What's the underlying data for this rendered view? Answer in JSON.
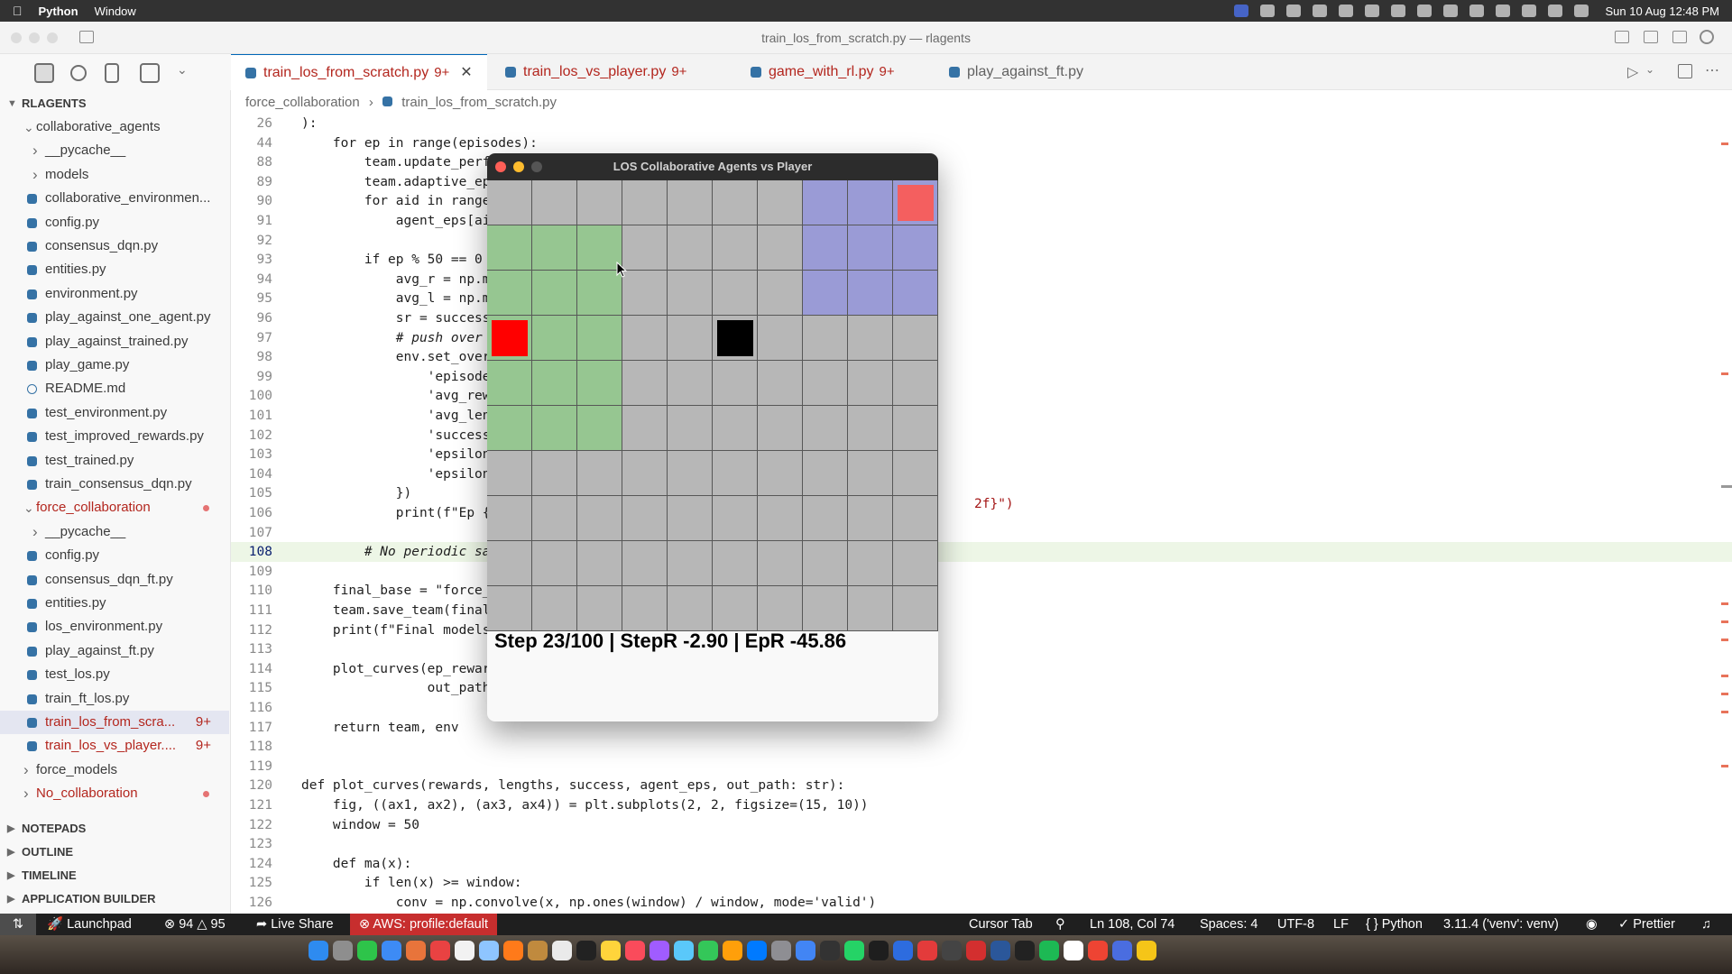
{
  "menubar": {
    "app_name": "Python",
    "menu_window": "Window",
    "clock": "Sun 10 Aug  12:48 PM"
  },
  "window": {
    "title": "train_los_from_scratch.py — rlagents"
  },
  "tabs": [
    {
      "label": "train_los_from_scratch.py",
      "badge": "9+",
      "active": true
    },
    {
      "label": "train_los_vs_player.py",
      "badge": "9+",
      "active": false
    },
    {
      "label": "game_with_rl.py",
      "badge": "9+",
      "active": false
    },
    {
      "label": "play_against_ft.py",
      "badge": "",
      "active": false
    }
  ],
  "sidebar": {
    "root": "RLAGENTS",
    "items": [
      {
        "label": "collaborative_agents",
        "kind": "folder-open",
        "indent": 0
      },
      {
        "label": "__pycache__",
        "kind": "folder",
        "indent": 1
      },
      {
        "label": "models",
        "kind": "folder",
        "indent": 1
      },
      {
        "label": "collaborative_environmen...",
        "kind": "py",
        "indent": 1
      },
      {
        "label": "config.py",
        "kind": "py",
        "indent": 1
      },
      {
        "label": "consensus_dqn.py",
        "kind": "py",
        "indent": 1
      },
      {
        "label": "entities.py",
        "kind": "py",
        "indent": 1
      },
      {
        "label": "environment.py",
        "kind": "py",
        "indent": 1
      },
      {
        "label": "play_against_one_agent.py",
        "kind": "py",
        "indent": 1
      },
      {
        "label": "play_against_trained.py",
        "kind": "py",
        "indent": 1
      },
      {
        "label": "play_game.py",
        "kind": "py",
        "indent": 1
      },
      {
        "label": "README.md",
        "kind": "info",
        "indent": 1
      },
      {
        "label": "test_environment.py",
        "kind": "py",
        "indent": 1
      },
      {
        "label": "test_improved_rewards.py",
        "kind": "py",
        "indent": 1
      },
      {
        "label": "test_trained.py",
        "kind": "py",
        "indent": 1
      },
      {
        "label": "train_consensus_dqn.py",
        "kind": "py",
        "indent": 1
      },
      {
        "label": "force_collaboration",
        "kind": "folder-open-mod",
        "indent": 0
      },
      {
        "label": "__pycache__",
        "kind": "folder",
        "indent": 1
      },
      {
        "label": "config.py",
        "kind": "py",
        "indent": 1
      },
      {
        "label": "consensus_dqn_ft.py",
        "kind": "py",
        "indent": 1
      },
      {
        "label": "entities.py",
        "kind": "py",
        "indent": 1
      },
      {
        "label": "los_environment.py",
        "kind": "py",
        "indent": 1
      },
      {
        "label": "play_against_ft.py",
        "kind": "py",
        "indent": 1
      },
      {
        "label": "test_los.py",
        "kind": "py",
        "indent": 1
      },
      {
        "label": "train_ft_los.py",
        "kind": "py",
        "indent": 1
      },
      {
        "label": "train_los_from_scra...",
        "kind": "py-mod-sel",
        "indent": 1,
        "badge": "9+"
      },
      {
        "label": "train_los_vs_player....",
        "kind": "py-mod",
        "indent": 1,
        "badge": "9+"
      },
      {
        "label": "force_models",
        "kind": "folder",
        "indent": 0
      },
      {
        "label": "No_collaboration",
        "kind": "folder-mod",
        "indent": 0
      }
    ],
    "sections": [
      "NOTEPADS",
      "OUTLINE",
      "TIMELINE",
      "APPLICATION BUILDER"
    ]
  },
  "breadcrumb": {
    "folder": "force_collaboration",
    "file": "train_los_from_scratch.py"
  },
  "editor": {
    "lines": [
      {
        "n": "26",
        "t": "):"
      },
      {
        "n": "44",
        "t": "    for ep in range(episodes):"
      },
      {
        "n": "88",
        "t": "        team.update_perf"
      },
      {
        "n": "89",
        "t": "        team.adaptive_ep"
      },
      {
        "n": "90",
        "t": "        for aid in range"
      },
      {
        "n": "91",
        "t": "            agent_eps[ai"
      },
      {
        "n": "92",
        "t": ""
      },
      {
        "n": "93",
        "t": "        if ep % 50 == 0"
      },
      {
        "n": "94",
        "t": "            avg_r = np.m"
      },
      {
        "n": "95",
        "t": "            avg_l = np.m"
      },
      {
        "n": "96",
        "t": "            sr = success"
      },
      {
        "n": "97",
        "t": "            # push over"
      },
      {
        "n": "98",
        "t": "            env.set_over"
      },
      {
        "n": "99",
        "t": "                'episode"
      },
      {
        "n": "100",
        "t": "                'avg_rew"
      },
      {
        "n": "101",
        "t": "                'avg_len"
      },
      {
        "n": "102",
        "t": "                'success"
      },
      {
        "n": "103",
        "t": "                'epsilon"
      },
      {
        "n": "104",
        "t": "                'epsilon"
      },
      {
        "n": "105",
        "t": "            })"
      },
      {
        "n": "106",
        "t": "            print(f\"Ep {"
      },
      {
        "n": "107",
        "t": ""
      },
      {
        "n": "108",
        "t": "        # No periodic sa"
      },
      {
        "n": "109",
        "t": ""
      },
      {
        "n": "110",
        "t": "    final_base = \"force_"
      },
      {
        "n": "111",
        "t": "    team.save_team(final"
      },
      {
        "n": "112",
        "t": "    print(f\"Final models"
      },
      {
        "n": "113",
        "t": ""
      },
      {
        "n": "114",
        "t": "    plot_curves(ep_rewar"
      },
      {
        "n": "115",
        "t": "                out_path"
      },
      {
        "n": "116",
        "t": ""
      },
      {
        "n": "117",
        "t": "    return team, env"
      },
      {
        "n": "118",
        "t": ""
      },
      {
        "n": "119",
        "t": ""
      },
      {
        "n": "120",
        "t": "def plot_curves(rewards, lengths, success, agent_eps, out_path: str):"
      },
      {
        "n": "121",
        "t": "    fig, ((ax1, ax2), (ax3, ax4)) = plt.subplots(2, 2, figsize=(15, 10))"
      },
      {
        "n": "122",
        "t": "    window = 50"
      },
      {
        "n": "123",
        "t": ""
      },
      {
        "n": "124",
        "t": "    def ma(x):"
      },
      {
        "n": "125",
        "t": "        if len(x) >= window:"
      },
      {
        "n": "126",
        "t": "            conv = np.convolve(x, np.ones(window) / window, mode='valid')"
      }
    ],
    "line106_tail": "2f}\")",
    "current_line": "108"
  },
  "game": {
    "title": "LOS Collaborative Agents vs Player",
    "status": "Step 23/100 | StepR -2.90 | EpR -45.86",
    "cols": 10,
    "rows": 10,
    "colors": {
      "grid": "#b7b7b7",
      "line": "#575757",
      "green": "#96c691",
      "blue": "#9a9bd6",
      "red": "#ff0000",
      "pink": "#f45f5f",
      "black": "#000000"
    }
  },
  "statusbar": {
    "launchpad": "Launchpad",
    "errors": "94",
    "warnings": "95",
    "live_share": "Live Share",
    "aws": "AWS: profile:default",
    "cursor_tab": "Cursor Tab",
    "position": "Ln 108, Col 74",
    "spaces": "Spaces: 4",
    "encoding": "UTF-8",
    "eol": "LF",
    "language": "Python",
    "interpreter": "3.11.4 ('venv': venv)",
    "prettier": "Prettier"
  }
}
